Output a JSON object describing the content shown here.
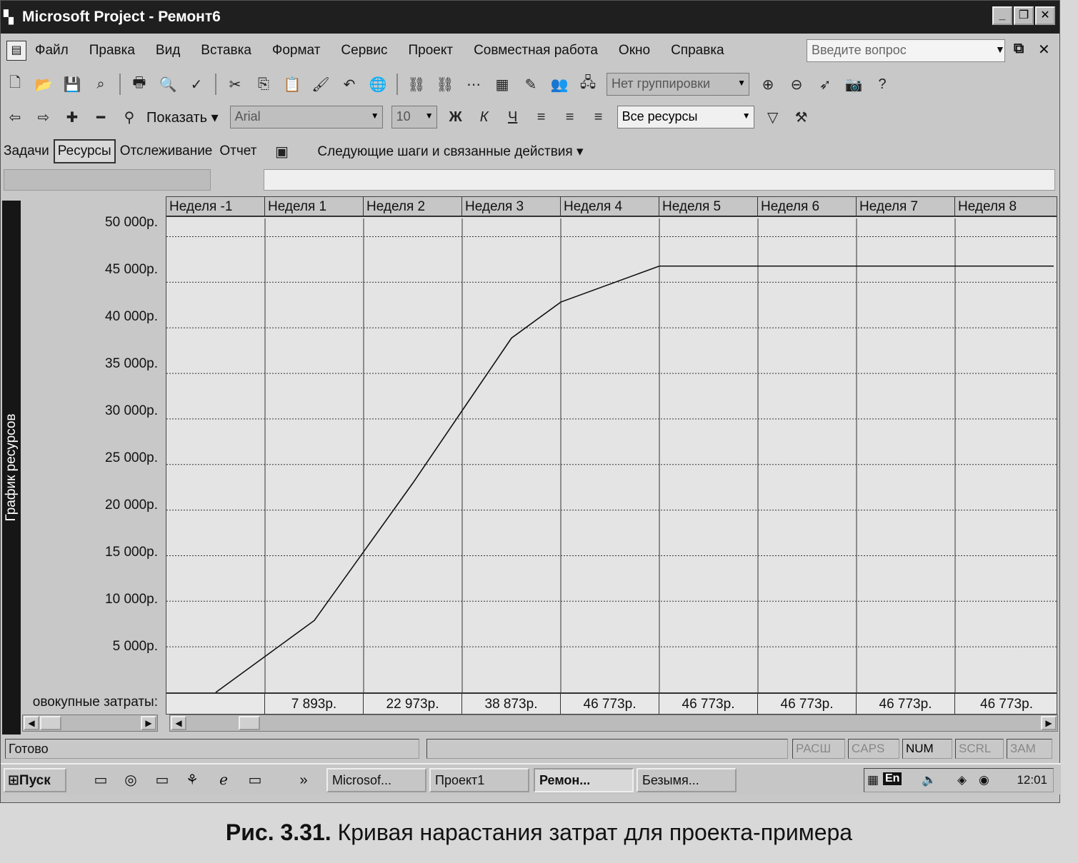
{
  "window": {
    "title": "Microsoft Project - Ремонт6"
  },
  "menubar": {
    "items": [
      "Файл",
      "Правка",
      "Вид",
      "Вставка",
      "Формат",
      "Сервис",
      "Проект",
      "Совместная работа",
      "Окно",
      "Справка"
    ],
    "question_placeholder": "Введите вопрос"
  },
  "toolbar": {
    "group_combo": "Нет группировки",
    "show_label": "Показать",
    "font_combo": "Arial",
    "size_combo": "10",
    "resources_combo": "Все ресурсы"
  },
  "views": {
    "items": [
      "Задачи",
      "Ресурсы",
      "Отслеживание",
      "Отчет"
    ],
    "active": "Ресурсы",
    "next_steps": "Следующие шаги и связанные действия"
  },
  "side_label": "График ресурсов",
  "cumulative_label": "овокупные затраты:",
  "chart_data": {
    "type": "line",
    "x_categories": [
      "Неделя -1",
      "Неделя 1",
      "Неделя 2",
      "Неделя 3",
      "Неделя 4",
      "Неделя 5",
      "Неделя 6",
      "Неделя 7",
      "Неделя 8"
    ],
    "y_tick_labels": [
      "50 000р.",
      "45 000р.",
      "40 000р.",
      "35 000р.",
      "30 000р.",
      "25 000р.",
      "20 000р.",
      "15 000р.",
      "10 000р.",
      "5 000р."
    ],
    "ylim": [
      0,
      52000
    ],
    "cumulative_values_text": [
      "",
      "7 893р.",
      "22 973р.",
      "38 873р.",
      "46 773р.",
      "46 773р.",
      "46 773р.",
      "46 773р.",
      "46 773р."
    ],
    "series": [
      {
        "x": [
          0.5,
          1.0,
          1.5,
          2.0,
          2.5,
          3.0,
          3.5,
          4.0,
          5.0,
          6.0,
          7.0,
          8.0,
          9.0
        ],
        "values": [
          0,
          3946,
          7893,
          15433,
          22973,
          30923,
          38873,
          42823,
          46773,
          46773,
          46773,
          46773,
          46773
        ]
      }
    ],
    "grid": true
  },
  "status": {
    "text": "Готово",
    "indicators": [
      "РАСШ",
      "CAPS",
      "NUM",
      "SCRL",
      "ЗАМ"
    ],
    "active_indicators": [
      "NUM"
    ]
  },
  "taskbar": {
    "start": "Пуск",
    "buttons": [
      "Microsof...",
      "Проект1",
      "Ремон...",
      "Безымя..."
    ],
    "active_button": "Ремон...",
    "lang": "En",
    "clock": "12:01"
  },
  "caption": {
    "prefix": "Рис. 3.31.",
    "text": "Кривая нарастания затрат для проекта-примера"
  }
}
